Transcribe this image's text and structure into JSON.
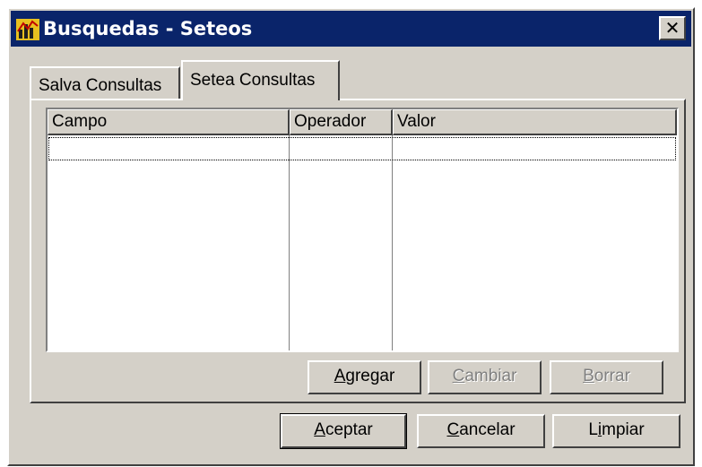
{
  "window": {
    "title": "Busquedas - Seteos",
    "close_glyph": "✕"
  },
  "tabs": [
    {
      "label": "Salva Consultas",
      "active": false
    },
    {
      "label": "Setea Consultas",
      "active": true
    }
  ],
  "grid": {
    "columns": [
      {
        "label": "Campo"
      },
      {
        "label": "Operador"
      },
      {
        "label": "Valor"
      }
    ],
    "rows": []
  },
  "panel_buttons": [
    {
      "label": "Agregar",
      "hotkey": "A",
      "enabled": true
    },
    {
      "label": "Cambiar",
      "hotkey": "C",
      "enabled": false
    },
    {
      "label": "Borrar",
      "hotkey": "B",
      "enabled": false
    }
  ],
  "dialog_buttons": [
    {
      "label": "Aceptar",
      "hotkey": "A",
      "enabled": true
    },
    {
      "label": "Cancelar",
      "hotkey": "C",
      "enabled": true
    },
    {
      "label": "Limpiar",
      "hotkey": "i",
      "enabled": true
    }
  ],
  "colors": {
    "titlebar": "#0a246a",
    "face": "#d4d0c8",
    "icon_accent": "#e8c020"
  },
  "icons": {
    "app": "app-chart-icon",
    "close": "close-icon"
  }
}
